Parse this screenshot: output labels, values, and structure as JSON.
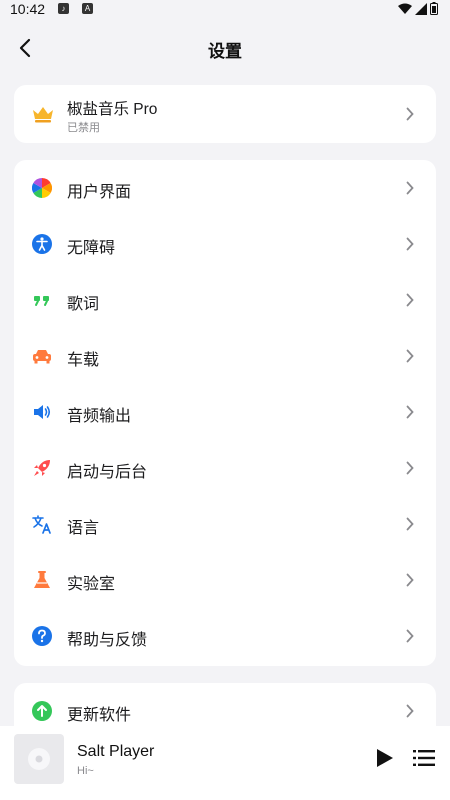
{
  "status_bar": {
    "time": "10:42"
  },
  "header": {
    "title": "设置"
  },
  "pro": {
    "label": "椒盐音乐 Pro",
    "sub": "已禁用"
  },
  "settings": [
    {
      "label": "用户界面",
      "icon": "palette-icon"
    },
    {
      "label": "无障碍",
      "icon": "accessibility-icon"
    },
    {
      "label": "歌词",
      "icon": "quote-icon"
    },
    {
      "label": "车载",
      "icon": "car-icon"
    },
    {
      "label": "音频输出",
      "icon": "speaker-icon"
    },
    {
      "label": "启动与后台",
      "icon": "rocket-icon"
    },
    {
      "label": "语言",
      "icon": "translate-icon"
    },
    {
      "label": "实验室",
      "icon": "flask-icon"
    },
    {
      "label": "帮助与反馈",
      "icon": "help-icon"
    }
  ],
  "update": {
    "label": "更新软件",
    "icon": "update-icon"
  },
  "player": {
    "title": "Salt Player",
    "sub": "Hi~"
  },
  "colors": {
    "background": "#f3f3f6",
    "card": "#ffffff",
    "accent_blue": "#1a73e8",
    "accent_green": "#34c759",
    "accent_orange": "#ff7a3d",
    "accent_red": "#ff4d4f"
  }
}
